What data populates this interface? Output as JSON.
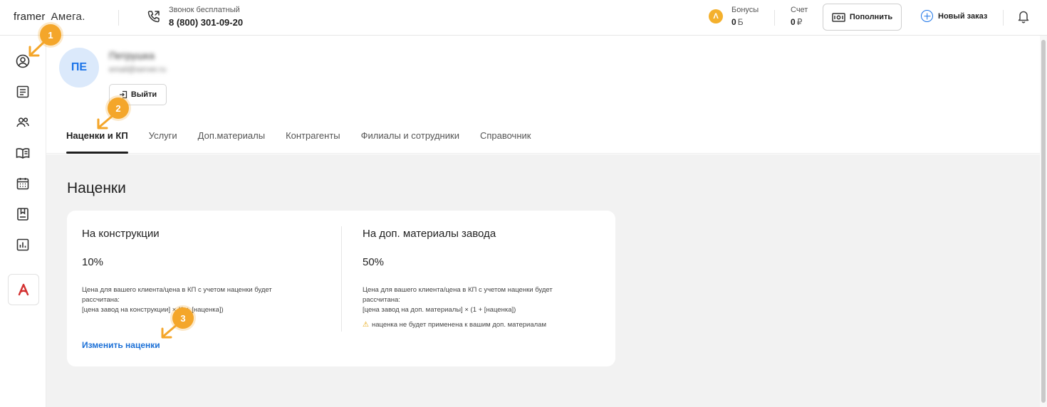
{
  "header": {
    "logo_framer": "framer",
    "logo_amega": "Амега.",
    "phone_label": "Звонок бесплатный",
    "phone_number": "8 (800) 301-09-20",
    "bonus_label": "Бонусы",
    "bonus_value": "0",
    "bonus_unit": "Б",
    "account_label": "Счет",
    "account_value": "0",
    "account_unit": "₽",
    "topup_label": "Пополнить",
    "neworder_label": "Новый заказ"
  },
  "sidebar": {
    "items": [
      "user-circle-icon",
      "document-icon",
      "users-icon",
      "book-icon",
      "calendar-icon",
      "bookmark-icon",
      "bar-chart-icon"
    ],
    "brand_icon": "amega-logo"
  },
  "profile": {
    "initials": "ПЕ",
    "name": "Петрушка",
    "email": "email@server.ru",
    "logout_label": "Выйти"
  },
  "tabs": [
    {
      "label": "Наценки и КП",
      "active": true
    },
    {
      "label": "Услуги",
      "active": false
    },
    {
      "label": "Доп.материалы",
      "active": false
    },
    {
      "label": "Контрагенты",
      "active": false
    },
    {
      "label": "Филиалы и сотрудники",
      "active": false
    },
    {
      "label": "Справочник",
      "active": false
    }
  ],
  "main": {
    "title": "Наценки",
    "constructions": {
      "title": "На конструкции",
      "value": "10%",
      "desc_line1": "Цена для вашего клиента/цена в КП с учетом наценки будет рассчитана:",
      "desc_line2": "[цена завод на  конструкции] × (1 + [наценка])",
      "edit_label": "Изменить наценки"
    },
    "materials": {
      "title": "На доп. материалы завода",
      "value": "50%",
      "desc_line1": "Цена для вашего клиента/цена в КП с учетом наценки будет рассчитана:",
      "desc_line2": "[цена завод на доп. материалы] × (1 + [наценка])",
      "warning": "наценка не будет применена к вашим доп. материалам"
    }
  },
  "markers": [
    "1",
    "2",
    "3"
  ],
  "colors": {
    "accent": "#1a73e8",
    "marker": "#f4a62a",
    "bonus": "#f4b02c",
    "brand_red": "#d32f2f"
  }
}
